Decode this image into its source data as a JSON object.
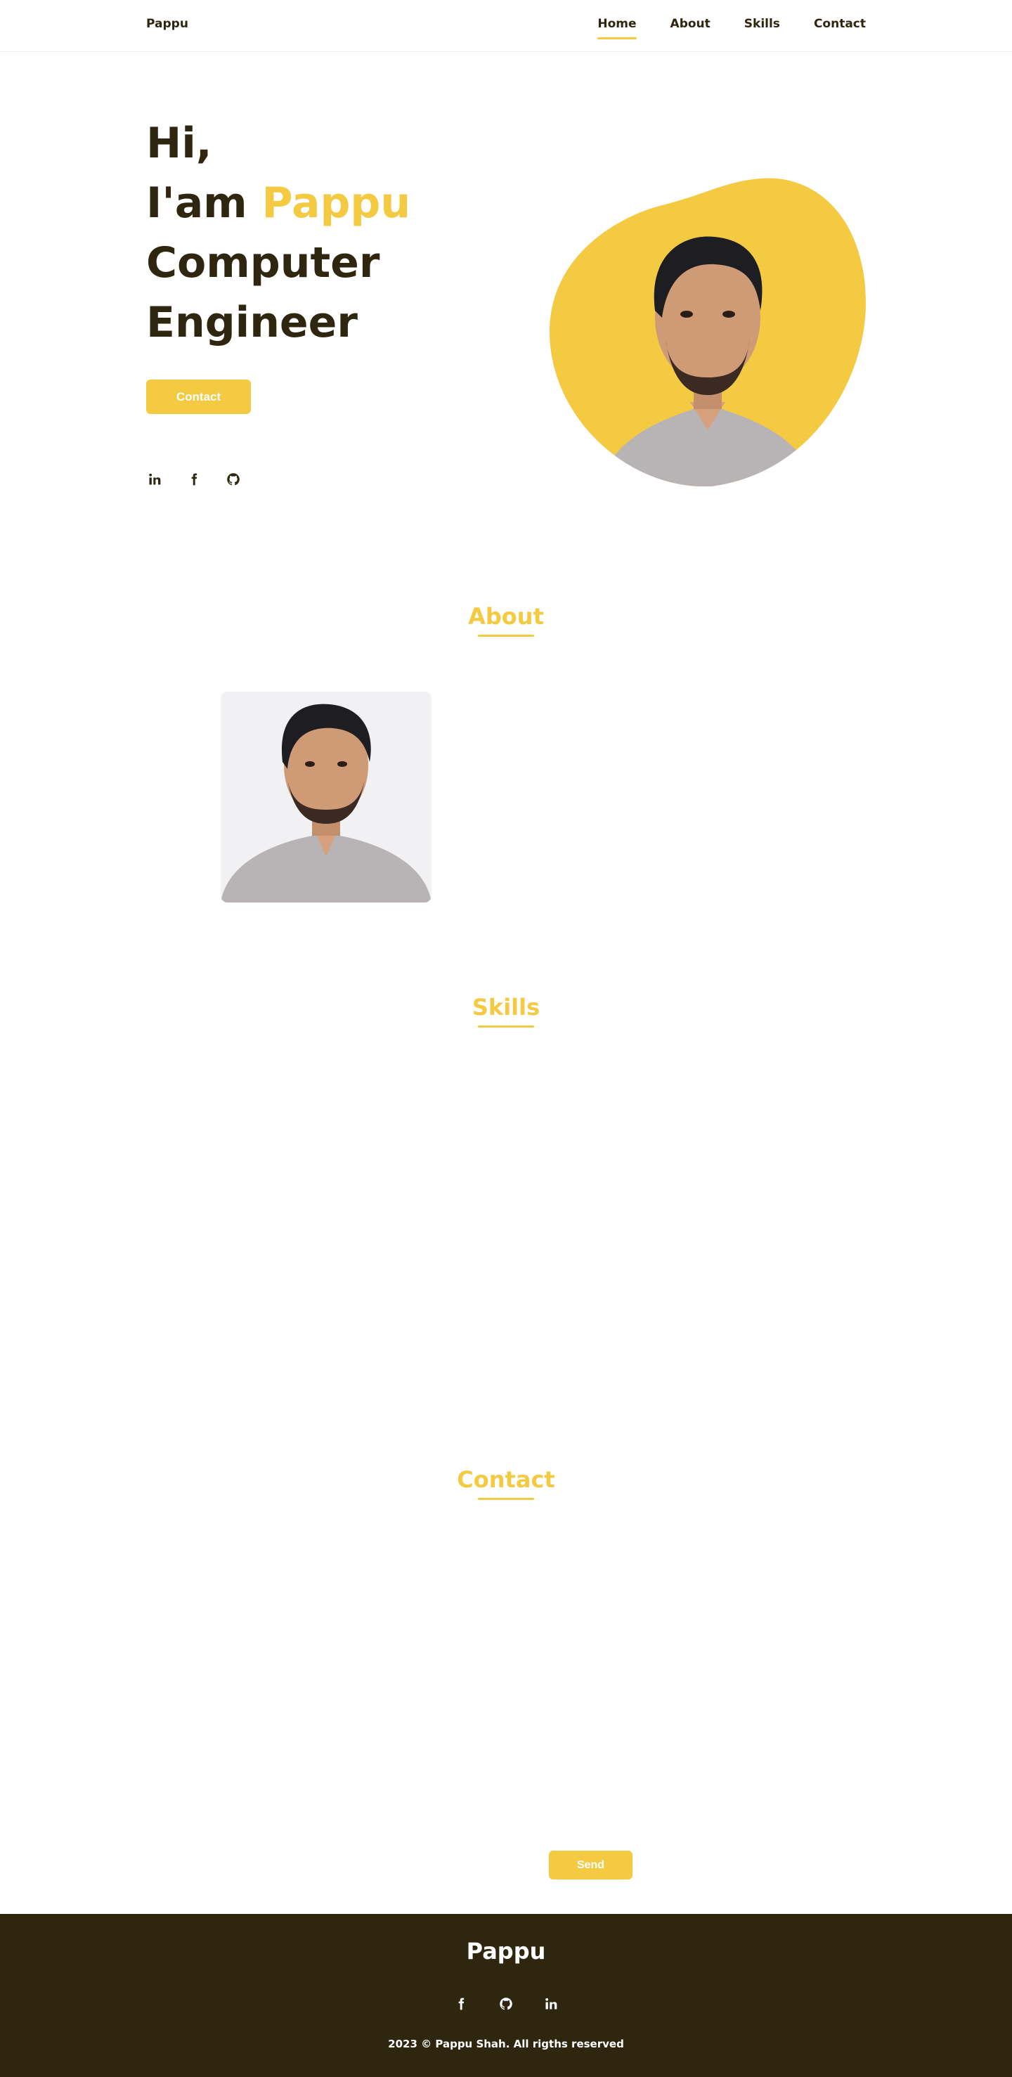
{
  "header": {
    "logo": "Pappu",
    "nav": [
      {
        "label": "Home",
        "active": true
      },
      {
        "label": "About",
        "active": false
      },
      {
        "label": "Skills",
        "active": false
      },
      {
        "label": "Contact",
        "active": false
      }
    ]
  },
  "hero": {
    "line1": "Hi,",
    "line2_prefix": "I'am ",
    "line2_name": "Pappu",
    "line3": "Computer",
    "line4": "Engineer",
    "button": "Contact",
    "social_icons": [
      "linkedin-icon",
      "facebook-icon",
      "github-icon"
    ]
  },
  "about": {
    "title": "About"
  },
  "skills": {
    "title": "Skills"
  },
  "contact": {
    "title": "Contact",
    "send_button": "Send"
  },
  "footer": {
    "title": "Pappu",
    "social_icons": [
      "facebook-icon",
      "github-icon",
      "linkedin-icon"
    ],
    "copyright": "2023 © Pappu Shah. All rigths reserved"
  },
  "colors": {
    "accent": "#f4ca43",
    "dark": "#2f2610",
    "white": "#ffffff"
  }
}
